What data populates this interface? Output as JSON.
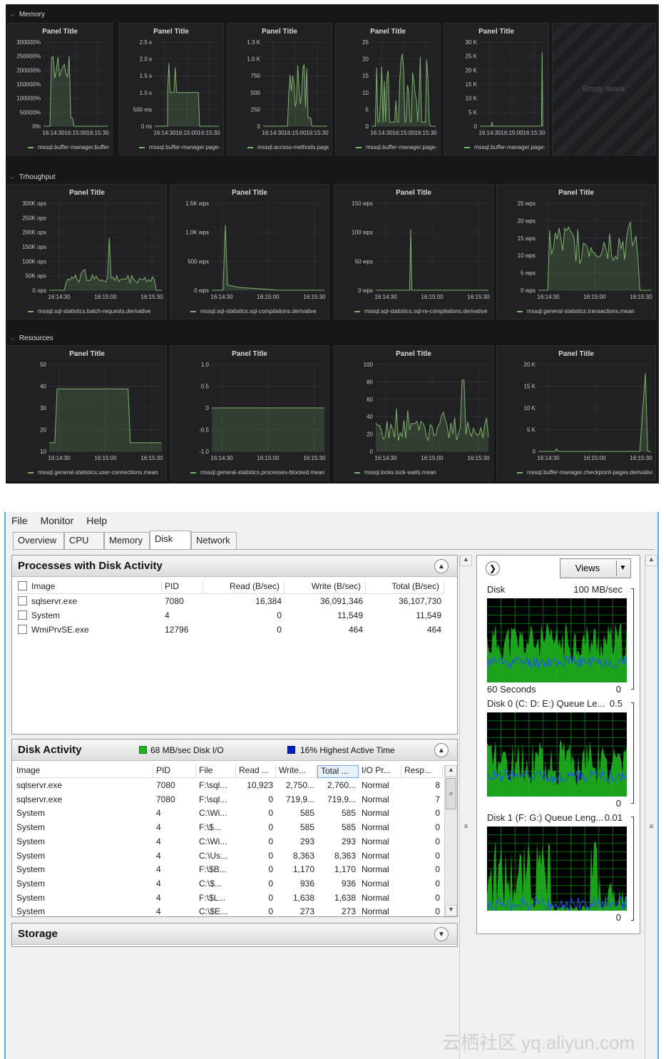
{
  "grafana": {
    "rows": [
      {
        "name": "Memory",
        "panels": [
          {
            "title": "Panel Title",
            "yticks": [
              "300000%",
              "250000%",
              "200000%",
              "150000%",
              "100000%",
              "50000%",
              "0%"
            ],
            "xticks": [
              "16:14:30",
              "16:15:00",
              "16:15:30"
            ],
            "legend": "mssql.buffer-manager.buffer-ca"
          },
          {
            "title": "Panel Title",
            "yticks": [
              "2.5 s",
              "2.0 s",
              "1.5 s",
              "1.0 s",
              "500 ms",
              "0 ns"
            ],
            "xticks": [
              "16:14:30",
              "16:15:00",
              "16:15:30"
            ],
            "legend": "mssql.buffer-manager.page-life"
          },
          {
            "title": "Panel Title",
            "yticks": [
              "1.3 K",
              "1.0 K",
              "750",
              "500",
              "250",
              "0"
            ],
            "xticks": [
              "16:14:30",
              "16:15:00",
              "16:15:30"
            ],
            "legend": "mssql.access-methods.page-spl"
          },
          {
            "title": "Panel Title",
            "yticks": [
              "25",
              "20",
              "15",
              "10",
              "5",
              "0"
            ],
            "xticks": [
              "16:14:30",
              "16:15:00",
              "16:15:30"
            ],
            "legend": "mssql.buffer-manager.page-rea"
          },
          {
            "title": "Panel Title",
            "yticks": [
              "30 K",
              "25 K",
              "20 K",
              "15 K",
              "10 K",
              "5 K",
              "0"
            ],
            "xticks": [
              "16:14:30",
              "16:15:00",
              "16:15:30"
            ],
            "legend": "mssql.buffer-manager.page-writes.derivative"
          }
        ],
        "empty_space": "Empty Space"
      },
      {
        "name": "Trhoughput",
        "panels": [
          {
            "title": "Panel Title",
            "yticks": [
              "300K ops",
              "250K ops",
              "200K ops",
              "150K ops",
              "100K ops",
              "50K ops",
              "0 ops"
            ],
            "xticks": [
              "16:14:30",
              "16:15:00",
              "16:15:30"
            ],
            "legend": "mssql.sql-statistics.batch-requests.derivative"
          },
          {
            "title": "Panel Title",
            "yticks": [
              "1.5K wps",
              "1.0K wps",
              "500 wps",
              "0 wps"
            ],
            "xticks": [
              "16:14:30",
              "16:15:00",
              "16:15:30"
            ],
            "legend": "mssql.sql-statistics.sql-compilations.derivative"
          },
          {
            "title": "Panel Title",
            "yticks": [
              "150 wps",
              "100 wps",
              "50 wps",
              "0 wps"
            ],
            "xticks": [
              "16:14:30",
              "16:15:00",
              "16:15:30"
            ],
            "legend": "mssql.sql-statistics.sql-re-compilations.derivative"
          },
          {
            "title": "Panel Title",
            "yticks": [
              "25 wps",
              "20 wps",
              "15 wps",
              "10 wps",
              "5 wps",
              "0 wps"
            ],
            "xticks": [
              "16:14:30",
              "16:15:00",
              "16:15:30"
            ],
            "legend": "mssql.general-statistics.transactions.mean"
          }
        ]
      },
      {
        "name": "Resources",
        "panels": [
          {
            "title": "Panel Title",
            "yticks": [
              "50",
              "40",
              "30",
              "20",
              "10"
            ],
            "xticks": [
              "16:14:30",
              "16:15:00",
              "16:15:30"
            ],
            "legend": "mssql.general-statistics.user-connections.mean"
          },
          {
            "title": "Panel Title",
            "yticks": [
              "1.0",
              "0.5",
              "0",
              "-0.5",
              "-1.0"
            ],
            "xticks": [
              "16:14:30",
              "16:15:00",
              "16:15:30"
            ],
            "legend": "mssql.general-statistics.processes-blocked.mean"
          },
          {
            "title": "Panel Title",
            "yticks": [
              "100",
              "80",
              "60",
              "40",
              "20",
              "0"
            ],
            "xticks": [
              "16:14:30",
              "16:15:00",
              "16:15:30"
            ],
            "legend": "mssql.locks.lock-waits.mean"
          },
          {
            "title": "Panel Title",
            "yticks": [
              "20 K",
              "15 K",
              "10 K",
              "5 K",
              "0"
            ],
            "xticks": [
              "16:14:30",
              "16:15:00",
              "16:15:30"
            ],
            "legend": "mssql.buffer-manager.checkpoint-pages.derivative"
          }
        ]
      }
    ],
    "colors": {
      "series": "#7eb26d",
      "bg": "#161719",
      "panel": "#212124"
    }
  },
  "resmon": {
    "menu": [
      "File",
      "Monitor",
      "Help"
    ],
    "tabs": [
      "Overview",
      "CPU",
      "Memory",
      "Disk",
      "Network"
    ],
    "active_tab": "Disk",
    "processes": {
      "title": "Processes with Disk Activity",
      "columns": [
        "Image",
        "PID",
        "Read (B/sec)",
        "Write (B/sec)",
        "Total (B/sec)"
      ],
      "rows": [
        [
          "sqlservr.exe",
          "7080",
          "16,384",
          "36,091,346",
          "36,107,730"
        ],
        [
          "System",
          "4",
          "0",
          "11,549",
          "11,549"
        ],
        [
          "WmiPrvSE.exe",
          "12796",
          "0",
          "464",
          "464"
        ]
      ]
    },
    "disk_activity": {
      "title": "Disk Activity",
      "io": "68 MB/sec Disk I/O",
      "active_time": "16% Highest Active Time",
      "io_color": "#1fb21f",
      "active_color": "#0020c0",
      "columns": [
        "Image",
        "PID",
        "File",
        "Read ...",
        "Write...",
        "Total ...",
        "I/O Pr...",
        "Resp..."
      ],
      "rows": [
        [
          "sqlservr.exe",
          "7080",
          "F:\\sql...",
          "10,923",
          "2,750...",
          "2,760...",
          "Normal",
          "8"
        ],
        [
          "sqlservr.exe",
          "7080",
          "F:\\sql...",
          "0",
          "719,9...",
          "719,9...",
          "Normal",
          "7"
        ],
        [
          "System",
          "4",
          "C:\\Wi...",
          "0",
          "585",
          "585",
          "Normal",
          "0"
        ],
        [
          "System",
          "4",
          "F:\\$...",
          "0",
          "585",
          "585",
          "Normal",
          "0"
        ],
        [
          "System",
          "4",
          "C:\\Wi...",
          "0",
          "293",
          "293",
          "Normal",
          "0"
        ],
        [
          "System",
          "4",
          "C:\\Us...",
          "0",
          "8,363",
          "8,363",
          "Normal",
          "0"
        ],
        [
          "System",
          "4",
          "F:\\$B...",
          "0",
          "1,170",
          "1,170",
          "Normal",
          "0"
        ],
        [
          "System",
          "4",
          "C:\\$...",
          "0",
          "936",
          "936",
          "Normal",
          "0"
        ],
        [
          "System",
          "4",
          "F:\\$L...",
          "0",
          "1,638",
          "1,638",
          "Normal",
          "0"
        ],
        [
          "System",
          "4",
          "C:\\$E...",
          "0",
          "273",
          "273",
          "Normal",
          "0"
        ]
      ]
    },
    "storage": {
      "title": "Storage"
    },
    "right_pane": {
      "views": "Views",
      "graphs": [
        {
          "label": "Disk",
          "max": "100 MB/sec",
          "bottom_left": "60 Seconds",
          "bottom_right": "0"
        },
        {
          "label": "Disk 0 (C: D: E:) Queue Le...",
          "max": "0.5",
          "bottom_right": "0"
        },
        {
          "label": "Disk 1 (F: G:) Queue Leng...",
          "max": "0.01",
          "bottom_right": "0"
        }
      ]
    },
    "watermark": "云栖社区 yq.aliyun.com"
  }
}
